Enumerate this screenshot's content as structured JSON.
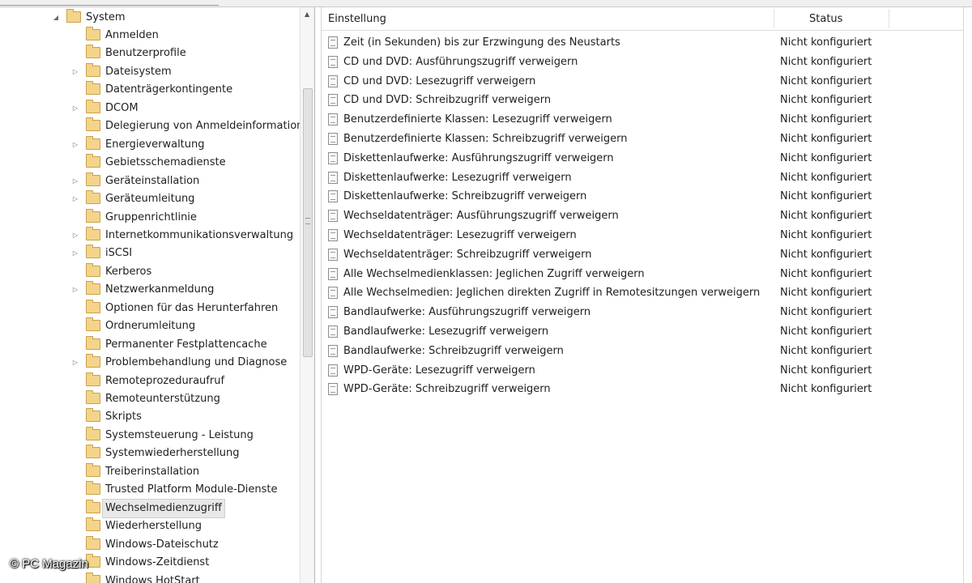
{
  "tree": {
    "parent": {
      "label": "System",
      "expander": "expanded"
    },
    "items": [
      {
        "label": "Anmelden",
        "expander": ""
      },
      {
        "label": "Benutzerprofile",
        "expander": ""
      },
      {
        "label": "Dateisystem",
        "expander": "collapsed"
      },
      {
        "label": "Datenträgerkontingente",
        "expander": ""
      },
      {
        "label": "DCOM",
        "expander": "collapsed"
      },
      {
        "label": "Delegierung von Anmeldeinformationen",
        "expander": ""
      },
      {
        "label": "Energieverwaltung",
        "expander": "collapsed"
      },
      {
        "label": "Gebietsschemadienste",
        "expander": ""
      },
      {
        "label": "Geräteinstallation",
        "expander": "collapsed"
      },
      {
        "label": "Geräteumleitung",
        "expander": "collapsed"
      },
      {
        "label": "Gruppenrichtlinie",
        "expander": ""
      },
      {
        "label": "Internetkommunikationsverwaltung",
        "expander": "collapsed"
      },
      {
        "label": "iSCSI",
        "expander": "collapsed"
      },
      {
        "label": "Kerberos",
        "expander": ""
      },
      {
        "label": "Netzwerkanmeldung",
        "expander": "collapsed"
      },
      {
        "label": "Optionen für das Herunterfahren",
        "expander": ""
      },
      {
        "label": "Ordnerumleitung",
        "expander": ""
      },
      {
        "label": "Permanenter Festplattencache",
        "expander": ""
      },
      {
        "label": "Problembehandlung und Diagnose",
        "expander": "collapsed"
      },
      {
        "label": "Remoteprozeduraufruf",
        "expander": ""
      },
      {
        "label": "Remoteunterstützung",
        "expander": ""
      },
      {
        "label": "Skripts",
        "expander": ""
      },
      {
        "label": "Systemsteuerung - Leistung",
        "expander": ""
      },
      {
        "label": "Systemwiederherstellung",
        "expander": ""
      },
      {
        "label": "Treiberinstallation",
        "expander": ""
      },
      {
        "label": "Trusted Platform Module-Dienste",
        "expander": ""
      },
      {
        "label": "Wechselmedienzugriff",
        "expander": "",
        "selected": true
      },
      {
        "label": "Wiederherstellung",
        "expander": ""
      },
      {
        "label": "Windows-Dateischutz",
        "expander": ""
      },
      {
        "label": "Windows-Zeitdienst",
        "expander": "collapsed"
      },
      {
        "label": "Windows HotStart",
        "expander": ""
      }
    ]
  },
  "list": {
    "columns": {
      "name": "Einstellung",
      "status": "Status"
    },
    "rows": [
      {
        "name": "Zeit (in Sekunden) bis zur Erzwingung des Neustarts",
        "status": "Nicht konfiguriert"
      },
      {
        "name": "CD und DVD: Ausführungszugriff verweigern",
        "status": "Nicht konfiguriert"
      },
      {
        "name": "CD und DVD: Lesezugriff verweigern",
        "status": "Nicht konfiguriert"
      },
      {
        "name": "CD und DVD: Schreibzugriff verweigern",
        "status": "Nicht konfiguriert"
      },
      {
        "name": "Benutzerdefinierte Klassen: Lesezugriff verweigern",
        "status": "Nicht konfiguriert"
      },
      {
        "name": "Benutzerdefinierte Klassen: Schreibzugriff verweigern",
        "status": "Nicht konfiguriert"
      },
      {
        "name": "Diskettenlaufwerke: Ausführungszugriff verweigern",
        "status": "Nicht konfiguriert"
      },
      {
        "name": "Diskettenlaufwerke: Lesezugriff verweigern",
        "status": "Nicht konfiguriert"
      },
      {
        "name": "Diskettenlaufwerke: Schreibzugriff verweigern",
        "status": "Nicht konfiguriert"
      },
      {
        "name": "Wechseldatenträger: Ausführungszugriff verweigern",
        "status": "Nicht konfiguriert"
      },
      {
        "name": "Wechseldatenträger: Lesezugriff verweigern",
        "status": "Nicht konfiguriert"
      },
      {
        "name": "Wechseldatenträger: Schreibzugriff verweigern",
        "status": "Nicht konfiguriert"
      },
      {
        "name": "Alle Wechselmedienklassen: Jeglichen Zugriff verweigern",
        "status": "Nicht konfiguriert"
      },
      {
        "name": "Alle Wechselmedien: Jeglichen direkten Zugriff in Remotesitzungen verweigern",
        "status": "Nicht konfiguriert"
      },
      {
        "name": "Bandlaufwerke: Ausführungszugriff verweigern",
        "status": "Nicht konfiguriert"
      },
      {
        "name": "Bandlaufwerke: Lesezugriff verweigern",
        "status": "Nicht konfiguriert"
      },
      {
        "name": "Bandlaufwerke: Schreibzugriff verweigern",
        "status": "Nicht konfiguriert"
      },
      {
        "name": "WPD-Geräte: Lesezugriff verweigern",
        "status": "Nicht konfiguriert"
      },
      {
        "name": "WPD-Geräte: Schreibzugriff verweigern",
        "status": "Nicht konfiguriert"
      }
    ]
  },
  "watermark": "© PC Magazin",
  "icons": {
    "expanded": "tree-expanded-icon",
    "collapsed": "tree-collapsed-icon",
    "folder": "folder-icon",
    "setting": "policy-setting-icon"
  }
}
